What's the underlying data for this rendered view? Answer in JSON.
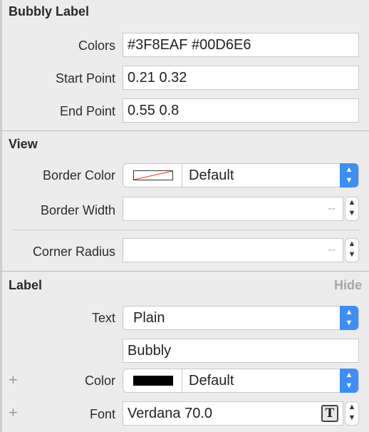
{
  "bubbly_label": {
    "title": "Bubbly Label",
    "colors_label": "Colors",
    "colors_value": "#3F8EAF #00D6E6",
    "start_point_label": "Start Point",
    "start_point_value": "0.21 0.32",
    "end_point_label": "End Point",
    "end_point_value": "0.55 0.8"
  },
  "view": {
    "title": "View",
    "border_color_label": "Border Color",
    "border_color_value": "Default",
    "border_width_label": "Border Width",
    "border_width_placeholder": "--",
    "corner_radius_label": "Corner Radius",
    "corner_radius_placeholder": "--"
  },
  "label": {
    "title": "Label",
    "hide_label": "Hide",
    "text_label": "Text",
    "text_value": "Plain",
    "text_content": "Bubbly",
    "color_label": "Color",
    "color_value": "Default",
    "font_label": "Font",
    "font_value": "Verdana 70.0",
    "add_symbol": "+"
  },
  "icons": {
    "stepper": "up-down-stepper-icon",
    "popup_arrow": "up-down-chevron-icon",
    "font_picker": "font-t-icon",
    "clear_color_swatch": "no-color-swatch",
    "black_color_swatch": "black-swatch"
  },
  "colors": {
    "accent": "#3d8ef7",
    "swatch_black": "#000000",
    "swatch_strike": "#e0352b"
  }
}
